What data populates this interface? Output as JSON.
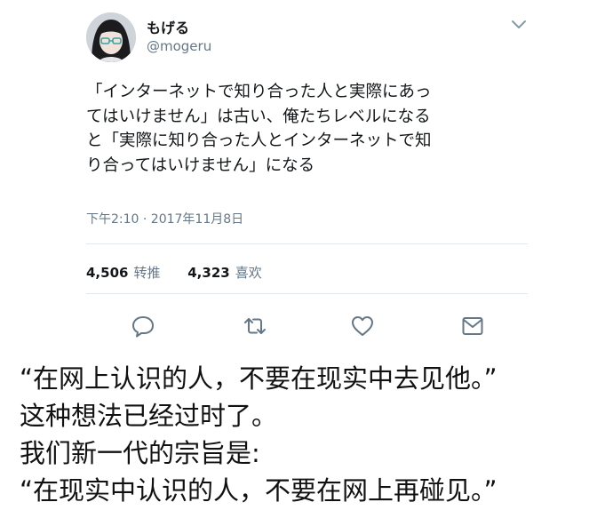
{
  "tweet": {
    "author": {
      "display_name": "もげる",
      "handle": "@mogeru"
    },
    "text_lines": [
      "「インターネットで知り合った人と実際にあっ",
      "てはいけません」は古い、俺たちレベルになる",
      "と「実際に知り合った人とインターネットで知",
      "り合ってはいけません」になる"
    ],
    "timestamp": "下午2:10 · 2017年11月8日",
    "stats": {
      "retweets": {
        "count": "4,506",
        "label": "转推"
      },
      "likes": {
        "count": "4,323",
        "label": "喜欢"
      }
    },
    "actions": {
      "reply_icon": "reply-icon",
      "retweet_icon": "retweet-icon",
      "like_icon": "heart-icon",
      "message_icon": "envelope-icon"
    },
    "colors": {
      "text": "#14171a",
      "secondary": "#657786",
      "divider": "#e1e8ed"
    }
  },
  "caption": {
    "lines": [
      "“在网上认识的人，不要在现实中去见他。”",
      "这种想法已经过时了。",
      "我们新一代的宗旨是:",
      "“在现实中认识的人，不要在网上再碰见。”"
    ]
  }
}
